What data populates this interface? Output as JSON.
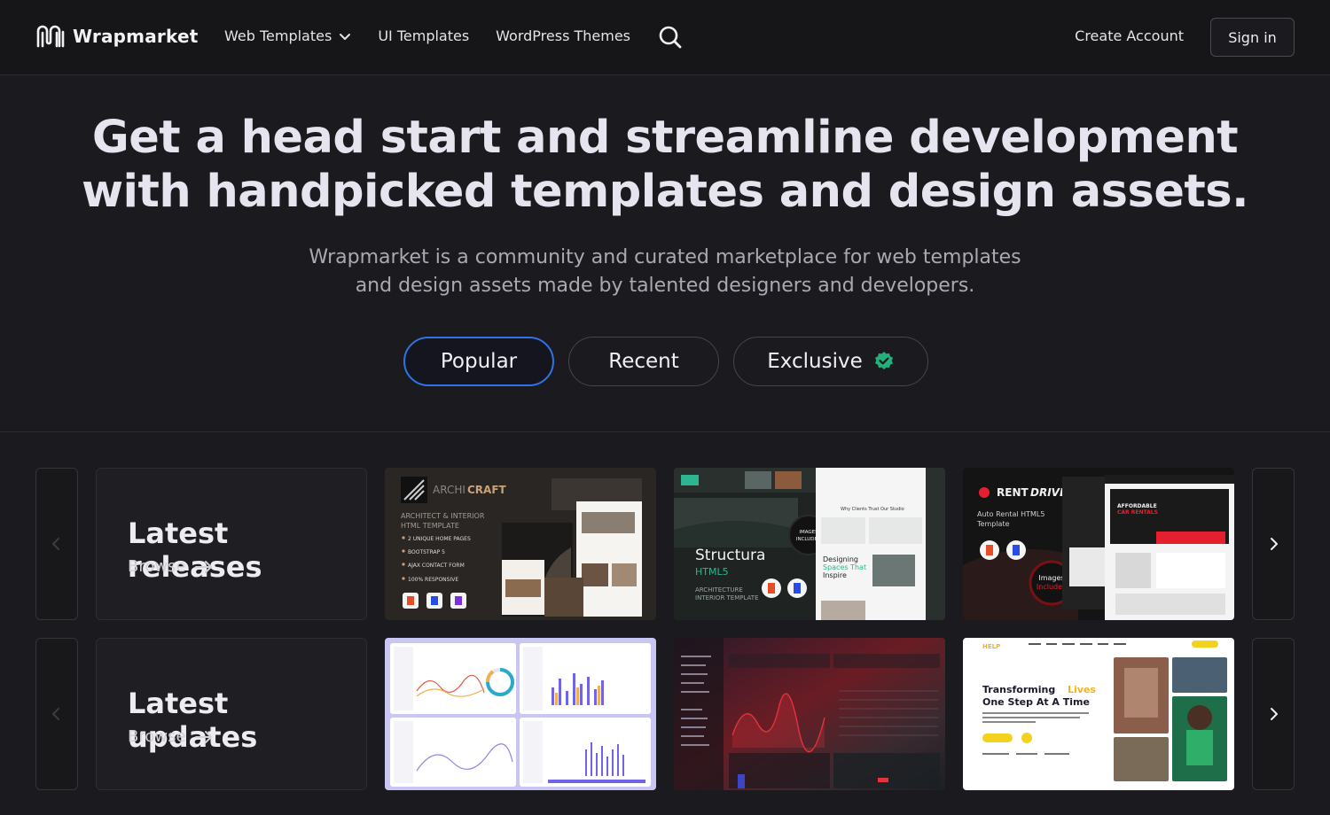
{
  "brand": {
    "name": "Wrapmarket"
  },
  "nav": {
    "items": [
      {
        "label": "Web Templates",
        "has_dropdown": true
      },
      {
        "label": "UI Templates"
      },
      {
        "label": "WordPress Themes"
      }
    ],
    "search_icon": "search-icon",
    "create_account": "Create Account",
    "sign_in": "Sign in"
  },
  "hero": {
    "title_line1": "Get a head start and streamline development",
    "title_line2": "with handpicked templates and design assets.",
    "subtitle_line1": "Wrapmarket is a community and curated marketplace for web templates",
    "subtitle_line2": "and design assets made by talented designers and developers.",
    "filters": [
      {
        "label": "Popular",
        "active": true
      },
      {
        "label": "Recent",
        "active": false
      },
      {
        "label": "Exclusive",
        "active": false,
        "icon": "verified-badge-icon"
      }
    ]
  },
  "rows": [
    {
      "title": "Latest releases",
      "browse": "Browse",
      "items": [
        {
          "brand": "ARCHI",
          "brand_accent": "CRAFT",
          "subtitle_line1": "ARCHITECT & INTERIOR",
          "subtitle_line2": "HTML TEMPLATE",
          "bullets": [
            "2 UNIQUE HOME PAGES",
            "BOOTSTRAP 5",
            "AJAX CONTACT FORM",
            "100% RESPONSIVE"
          ]
        },
        {
          "name": "Structura",
          "version": "HTML5",
          "desc_line1": "ARCHITECTURE",
          "desc_line2": "INTERIOR TEMPLATE",
          "badge_line1": "IMAGES",
          "badge_line2": "INCLUDED",
          "heading": "Why Clients Trust Our Studio",
          "card_line1": "Designing",
          "card_line2": "Spaces That",
          "card_line3": "Inspire"
        },
        {
          "brand": "RENT",
          "brand_accent": "DRIVE",
          "desc_line1": "Auto Rental HTML5",
          "desc_line2": "Template",
          "badge_line1": "Images",
          "badge_line2": "Included",
          "promo_line1": "AFFORDABLE",
          "promo_line2": "CAR RENTALS"
        }
      ]
    },
    {
      "title": "Latest updates",
      "browse": "Browse",
      "items": [
        {
          "kind": "admin-dashboard-light"
        },
        {
          "kind": "admin-dashboard-dark"
        },
        {
          "brand": "HELP",
          "hero_line1a": "Transforming ",
          "hero_line1b": "Lives",
          "hero_line2": "One Step At A Time"
        }
      ]
    }
  ],
  "colors": {
    "background": "#1b1b1f",
    "header": "#161618",
    "accent_blue": "#2f74e6",
    "verified_green": "#22b07d"
  }
}
